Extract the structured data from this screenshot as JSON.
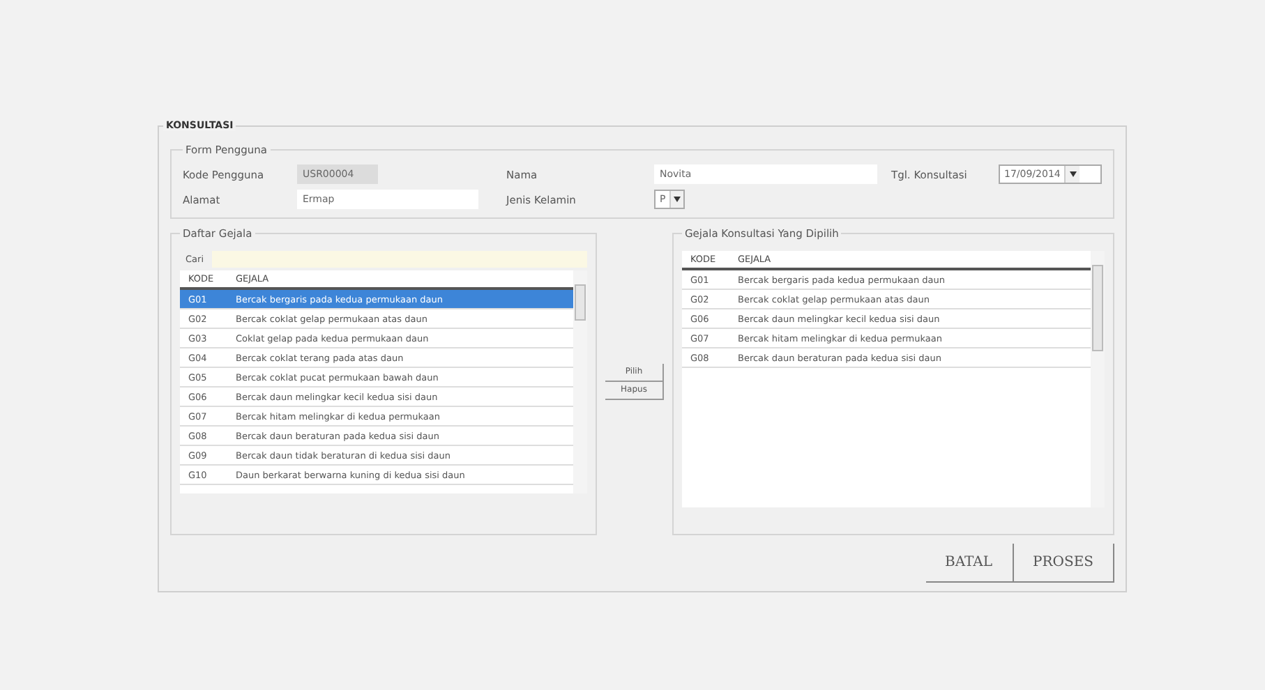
{
  "panel": {
    "title": "KONSULTASI"
  },
  "user_form": {
    "title": "Form Pengguna",
    "kode_pengguna": {
      "label": "Kode Pengguna",
      "value": "USR00004"
    },
    "alamat": {
      "label": "Alamat",
      "value": "Ermap"
    },
    "nama": {
      "label": "Nama",
      "value": "Novita"
    },
    "jenis_kelamin": {
      "label": "Jenis Kelamin",
      "value": "P"
    },
    "tgl_konsultasi": {
      "label": "Tgl. Konsultasi",
      "value": "17/09/2014"
    }
  },
  "symptom_list": {
    "title": "Daftar Gejala",
    "search_label": "Cari",
    "columns": [
      "KODE",
      "GEJALA"
    ],
    "rows": [
      {
        "kode": "G01",
        "gejala": "Bercak bergaris pada kedua permukaan daun",
        "selected": true
      },
      {
        "kode": "G02",
        "gejala": "Bercak coklat gelap permukaan atas daun",
        "selected": false
      },
      {
        "kode": "G03",
        "gejala": "Coklat gelap pada kedua permukaan daun",
        "selected": false
      },
      {
        "kode": "G04",
        "gejala": "Bercak coklat terang pada atas daun",
        "selected": false
      },
      {
        "kode": "G05",
        "gejala": "Bercak coklat pucat permukaan bawah daun",
        "selected": false
      },
      {
        "kode": "G06",
        "gejala": "Bercak daun melingkar kecil kedua sisi daun",
        "selected": false
      },
      {
        "kode": "G07",
        "gejala": "Bercak hitam melingkar di kedua permukaan",
        "selected": false
      },
      {
        "kode": "G08",
        "gejala": "Bercak daun beraturan pada kedua sisi daun",
        "selected": false
      },
      {
        "kode": "G09",
        "gejala": "Bercak daun tidak beraturan di kedua sisi daun",
        "selected": false
      },
      {
        "kode": "G10",
        "gejala": "Daun berkarat berwarna kuning di kedua sisi daun",
        "selected": false
      }
    ]
  },
  "transfer_buttons": [
    "Pilih",
    "Hapus"
  ],
  "selected_list": {
    "title": "Gejala Konsultasi Yang Dipilih",
    "columns": [
      "KODE",
      "GEJALA"
    ],
    "rows": [
      {
        "kode": "G01",
        "gejala": "Bercak bergaris pada kedua permukaan daun"
      },
      {
        "kode": "G02",
        "gejala": "Bercak coklat gelap permukaan atas daun"
      },
      {
        "kode": "G06",
        "gejala": "Bercak daun melingkar kecil kedua sisi daun"
      },
      {
        "kode": "G07",
        "gejala": "Bercak hitam melingkar di kedua permukaan"
      },
      {
        "kode": "G08",
        "gejala": "Bercak daun beraturan pada kedua sisi daun"
      }
    ]
  },
  "action_buttons": [
    "BATAL",
    "PROSES"
  ]
}
